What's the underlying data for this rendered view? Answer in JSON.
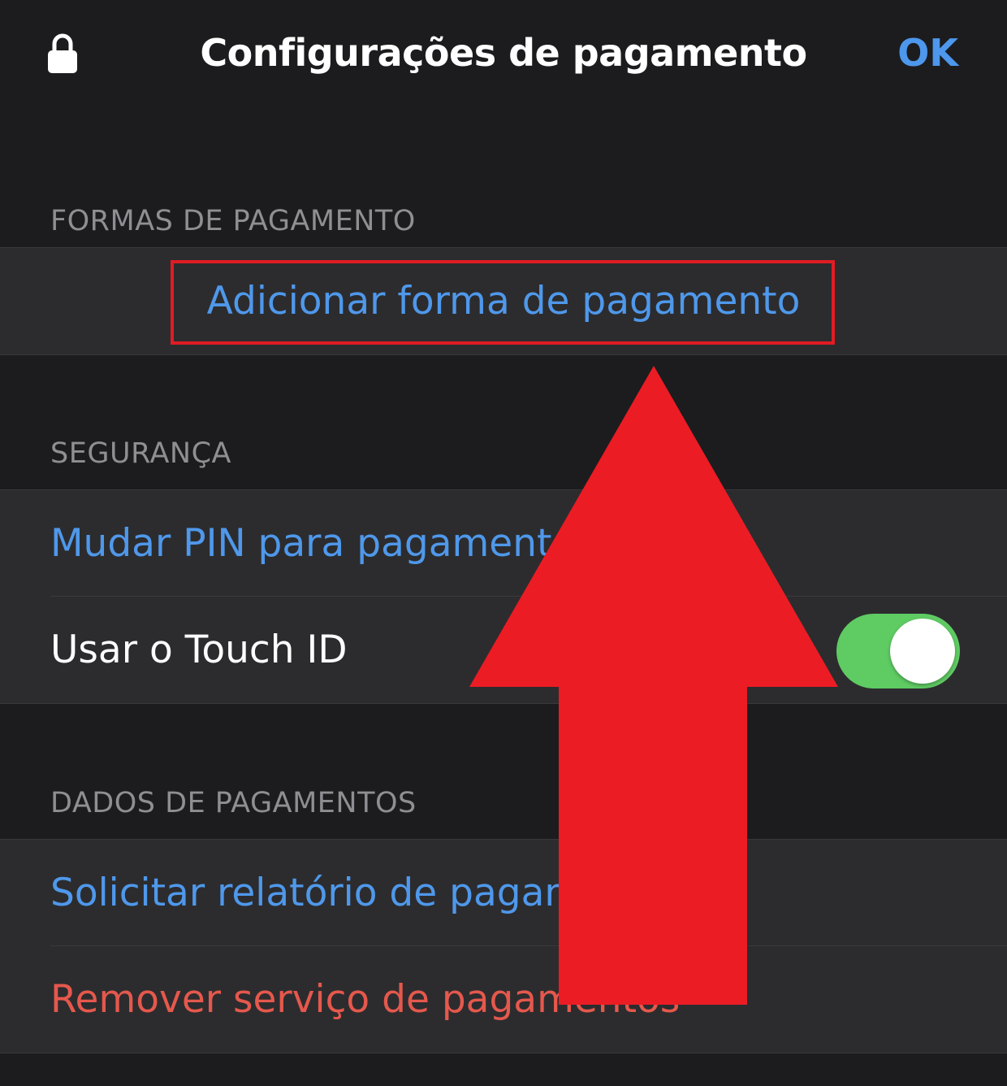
{
  "navbar": {
    "lock_icon": "lock-icon",
    "title": "Configurações de pagamento",
    "done_label": "OK"
  },
  "sections": {
    "payment_methods": {
      "header": "FORMAS DE PAGAMENTO",
      "add_label": "Adicionar forma de pagamento"
    },
    "security": {
      "header": "SEGURANÇA",
      "change_pin_label": "Mudar PIN para pagamentos",
      "touch_id_label": "Usar o Touch ID",
      "touch_id_enabled": true
    },
    "payment_data": {
      "header": "DADOS DE PAGAMENTOS",
      "request_report_label": "Solicitar relatório de pagamentos",
      "remove_service_label": "Remover serviço de pagamentos"
    }
  },
  "annotation": {
    "highlight_color": "#e01c24",
    "arrow_color": "#ec1c24",
    "arrow_icon": "up-arrow-icon"
  },
  "colors": {
    "background": "#1c1c1e",
    "cell_background": "#2c2c2e",
    "accent_blue": "#4f98eb",
    "destructive_red": "#e5584d",
    "toggle_green": "#5fcb63"
  }
}
